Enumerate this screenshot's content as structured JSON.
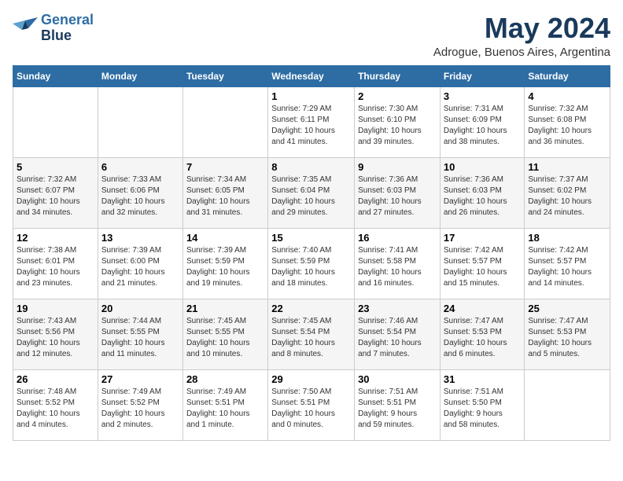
{
  "header": {
    "logo_line1": "General",
    "logo_line2": "Blue",
    "month_year": "May 2024",
    "location": "Adrogue, Buenos Aires, Argentina"
  },
  "weekdays": [
    "Sunday",
    "Monday",
    "Tuesday",
    "Wednesday",
    "Thursday",
    "Friday",
    "Saturday"
  ],
  "weeks": [
    [
      {
        "day": "",
        "info": ""
      },
      {
        "day": "",
        "info": ""
      },
      {
        "day": "",
        "info": ""
      },
      {
        "day": "1",
        "info": "Sunrise: 7:29 AM\nSunset: 6:11 PM\nDaylight: 10 hours\nand 41 minutes."
      },
      {
        "day": "2",
        "info": "Sunrise: 7:30 AM\nSunset: 6:10 PM\nDaylight: 10 hours\nand 39 minutes."
      },
      {
        "day": "3",
        "info": "Sunrise: 7:31 AM\nSunset: 6:09 PM\nDaylight: 10 hours\nand 38 minutes."
      },
      {
        "day": "4",
        "info": "Sunrise: 7:32 AM\nSunset: 6:08 PM\nDaylight: 10 hours\nand 36 minutes."
      }
    ],
    [
      {
        "day": "5",
        "info": "Sunrise: 7:32 AM\nSunset: 6:07 PM\nDaylight: 10 hours\nand 34 minutes."
      },
      {
        "day": "6",
        "info": "Sunrise: 7:33 AM\nSunset: 6:06 PM\nDaylight: 10 hours\nand 32 minutes."
      },
      {
        "day": "7",
        "info": "Sunrise: 7:34 AM\nSunset: 6:05 PM\nDaylight: 10 hours\nand 31 minutes."
      },
      {
        "day": "8",
        "info": "Sunrise: 7:35 AM\nSunset: 6:04 PM\nDaylight: 10 hours\nand 29 minutes."
      },
      {
        "day": "9",
        "info": "Sunrise: 7:36 AM\nSunset: 6:03 PM\nDaylight: 10 hours\nand 27 minutes."
      },
      {
        "day": "10",
        "info": "Sunrise: 7:36 AM\nSunset: 6:03 PM\nDaylight: 10 hours\nand 26 minutes."
      },
      {
        "day": "11",
        "info": "Sunrise: 7:37 AM\nSunset: 6:02 PM\nDaylight: 10 hours\nand 24 minutes."
      }
    ],
    [
      {
        "day": "12",
        "info": "Sunrise: 7:38 AM\nSunset: 6:01 PM\nDaylight: 10 hours\nand 23 minutes."
      },
      {
        "day": "13",
        "info": "Sunrise: 7:39 AM\nSunset: 6:00 PM\nDaylight: 10 hours\nand 21 minutes."
      },
      {
        "day": "14",
        "info": "Sunrise: 7:39 AM\nSunset: 5:59 PM\nDaylight: 10 hours\nand 19 minutes."
      },
      {
        "day": "15",
        "info": "Sunrise: 7:40 AM\nSunset: 5:59 PM\nDaylight: 10 hours\nand 18 minutes."
      },
      {
        "day": "16",
        "info": "Sunrise: 7:41 AM\nSunset: 5:58 PM\nDaylight: 10 hours\nand 16 minutes."
      },
      {
        "day": "17",
        "info": "Sunrise: 7:42 AM\nSunset: 5:57 PM\nDaylight: 10 hours\nand 15 minutes."
      },
      {
        "day": "18",
        "info": "Sunrise: 7:42 AM\nSunset: 5:57 PM\nDaylight: 10 hours\nand 14 minutes."
      }
    ],
    [
      {
        "day": "19",
        "info": "Sunrise: 7:43 AM\nSunset: 5:56 PM\nDaylight: 10 hours\nand 12 minutes."
      },
      {
        "day": "20",
        "info": "Sunrise: 7:44 AM\nSunset: 5:55 PM\nDaylight: 10 hours\nand 11 minutes."
      },
      {
        "day": "21",
        "info": "Sunrise: 7:45 AM\nSunset: 5:55 PM\nDaylight: 10 hours\nand 10 minutes."
      },
      {
        "day": "22",
        "info": "Sunrise: 7:45 AM\nSunset: 5:54 PM\nDaylight: 10 hours\nand 8 minutes."
      },
      {
        "day": "23",
        "info": "Sunrise: 7:46 AM\nSunset: 5:54 PM\nDaylight: 10 hours\nand 7 minutes."
      },
      {
        "day": "24",
        "info": "Sunrise: 7:47 AM\nSunset: 5:53 PM\nDaylight: 10 hours\nand 6 minutes."
      },
      {
        "day": "25",
        "info": "Sunrise: 7:47 AM\nSunset: 5:53 PM\nDaylight: 10 hours\nand 5 minutes."
      }
    ],
    [
      {
        "day": "26",
        "info": "Sunrise: 7:48 AM\nSunset: 5:52 PM\nDaylight: 10 hours\nand 4 minutes."
      },
      {
        "day": "27",
        "info": "Sunrise: 7:49 AM\nSunset: 5:52 PM\nDaylight: 10 hours\nand 2 minutes."
      },
      {
        "day": "28",
        "info": "Sunrise: 7:49 AM\nSunset: 5:51 PM\nDaylight: 10 hours\nand 1 minute."
      },
      {
        "day": "29",
        "info": "Sunrise: 7:50 AM\nSunset: 5:51 PM\nDaylight: 10 hours\nand 0 minutes."
      },
      {
        "day": "30",
        "info": "Sunrise: 7:51 AM\nSunset: 5:51 PM\nDaylight: 9 hours\nand 59 minutes."
      },
      {
        "day": "31",
        "info": "Sunrise: 7:51 AM\nSunset: 5:50 PM\nDaylight: 9 hours\nand 58 minutes."
      },
      {
        "day": "",
        "info": ""
      }
    ]
  ]
}
